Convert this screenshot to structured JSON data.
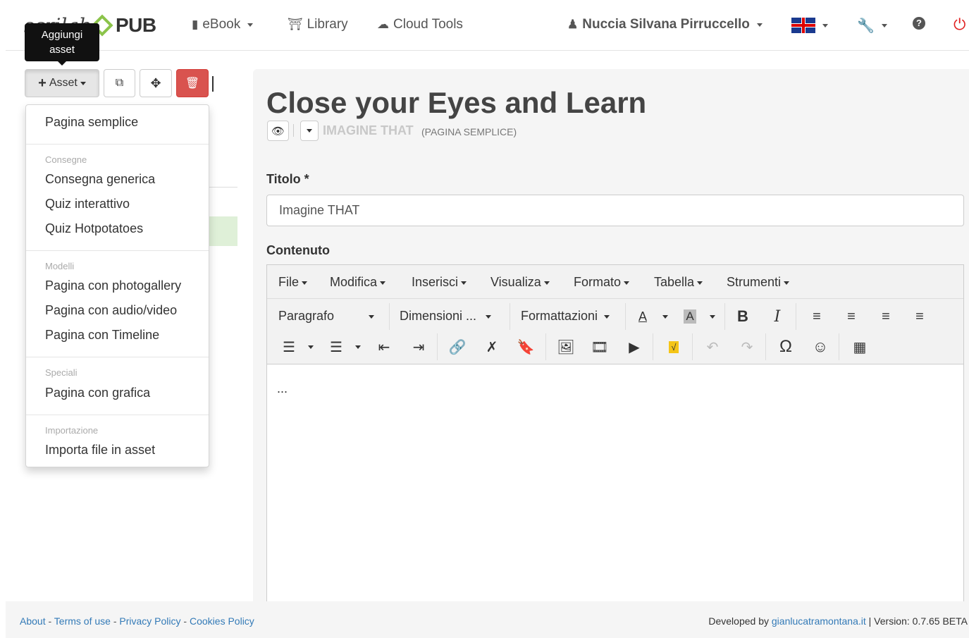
{
  "logo": {
    "script": "scrilab",
    "pub": "PUB"
  },
  "nav": {
    "ebook": "eBook",
    "library": "Library",
    "cloud_tools": "Cloud Tools",
    "user": "Nuccia Silvana Pirruccello",
    "ebook_icon": "book-icon",
    "library_icon": "bank-icon",
    "cloud_icon": "cloud-icon"
  },
  "tooltip": {
    "line1": "Aggiungi",
    "line2": "asset"
  },
  "toolbar_buttons": {
    "asset": "Asset"
  },
  "asset_menu": {
    "simple_page": "Pagina semplice",
    "group_consegne": "Consegne",
    "consegna_generica": "Consegna generica",
    "quiz_interattivo": "Quiz interattivo",
    "quiz_hotpotatoes": "Quiz Hotpotatoes",
    "group_modelli": "Modelli",
    "photogallery": "Pagina con photogallery",
    "audio_video": "Pagina con audio/video",
    "timeline": "Pagina con Timeline",
    "group_speciali": "Speciali",
    "grafica": "Pagina con grafica",
    "group_importazione": "Importazione",
    "importa": "Importa file in asset"
  },
  "page": {
    "title": "Close your Eyes and Learn",
    "subtitle": "IMAGINE THAT",
    "subtitle_type": "(PAGINA SEMPLICE)",
    "titolo_label": "Titolo *",
    "titolo_value": "Imagine THAT",
    "contenuto_label": "Contenuto"
  },
  "editor": {
    "menus": [
      "File",
      "Modifica",
      "Inserisci",
      "Visualiza",
      "Formato",
      "Tabella",
      "Strumenti"
    ],
    "paragraph": "Paragrafo",
    "dimensions": "Dimensioni ...",
    "formats": "Formattazioni",
    "content": "..."
  },
  "footer": {
    "about": "About",
    "terms": "Terms of use",
    "privacy": "Privacy Policy",
    "cookies": "Cookies Policy",
    "developed_by": "Developed by",
    "developer": "gianlucatramontana.it",
    "version": "| Version: 0.7.65 BETA"
  },
  "colors": {
    "delete_button": "#d9534f",
    "accent_green": "#8bc34a",
    "link": "#337ab7"
  }
}
